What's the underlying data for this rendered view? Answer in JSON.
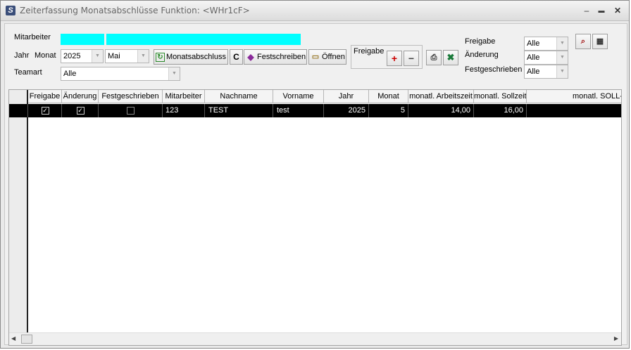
{
  "window": {
    "title": "Zeiterfassung Monatsabschlüsse Funktion: <WHr1cF>",
    "app_icon": "S",
    "controls": [
      "–",
      "▬",
      "✕"
    ]
  },
  "filters": {
    "mitarbeiter_label": "Mitarbeiter",
    "jahr_label": "Jahr",
    "monat_label": "Monat",
    "jahr_value": "2025",
    "monat_value": "Mai",
    "teamart_label": "Teamart",
    "teamart_value": "Alle"
  },
  "toolbar": {
    "monatsabschluss": "Monatsabschluss",
    "c_button": "C",
    "festschreiben": "Festschreiben",
    "oeffnen": "Öffnen",
    "freigabe_group_label": "Freigabe",
    "plus": "+",
    "minus": "−"
  },
  "right_filters": {
    "freigabe_label": "Freigabe",
    "freigabe_value": "Alle",
    "aenderung_label": "Änderung",
    "aenderung_value": "Alle",
    "festgeschrieben_label": "Festgeschrieben",
    "festgeschrieben_value": "Alle"
  },
  "table": {
    "columns": [
      "Freigabe",
      "Änderung",
      "Festgeschrieben",
      "Mitarbeiter",
      "Nachname",
      "Vorname",
      "Jahr",
      "Monat",
      "monatl. Arbeitszeit",
      "monatl. Sollzeit",
      "monatl. SOLL-I"
    ],
    "rows": [
      {
        "freigabe": true,
        "aenderung": true,
        "festgeschrieben": false,
        "mitarbeiter": "123",
        "nachname": "TEST",
        "vorname": "test",
        "jahr": "2025",
        "monat": "5",
        "arbeitszeit": "14,00",
        "sollzeit": "16,00",
        "soll_i": ""
      }
    ]
  },
  "colors": {
    "highlight": "#00ffff",
    "selected_row": "#000000"
  }
}
